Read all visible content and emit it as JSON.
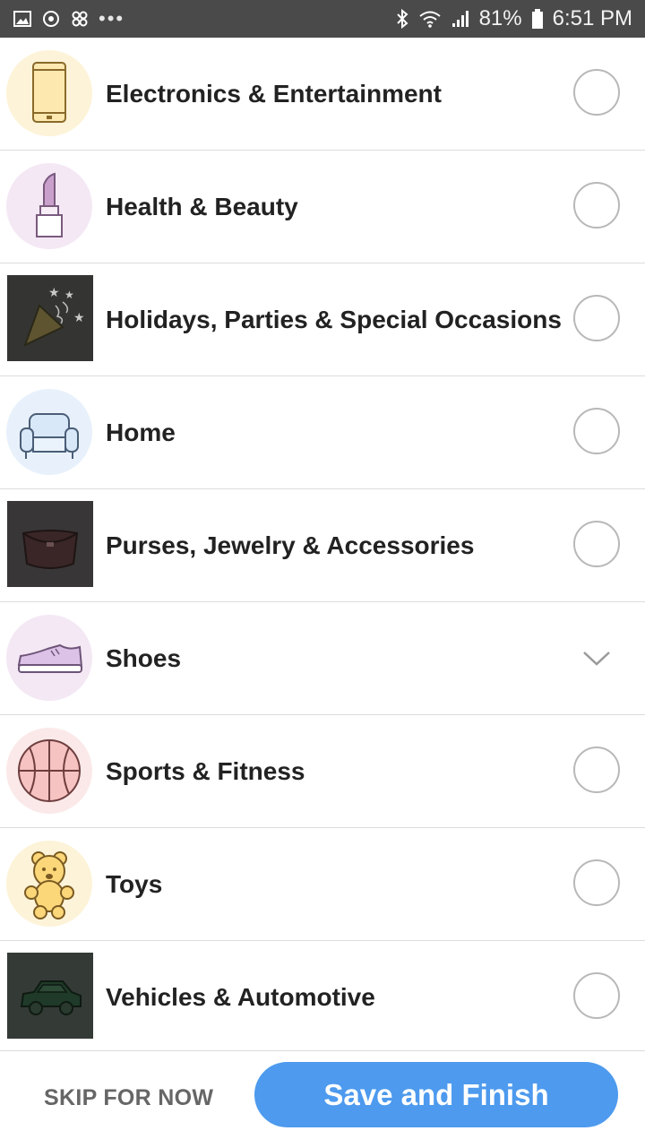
{
  "status_bar": {
    "battery": "81%",
    "time": "6:51 PM",
    "more": "•••",
    "icons": [
      "gallery-icon",
      "sync-icon",
      "pinwheel-icon",
      "bluetooth-icon",
      "wifi-icon",
      "signal-icon",
      "battery-icon"
    ]
  },
  "categories": [
    {
      "label": "Electronics & Entertainment",
      "icon": "smartphone-icon",
      "state": "unselected"
    },
    {
      "label": "Health & Beauty",
      "icon": "lipstick-icon",
      "state": "unselected"
    },
    {
      "label": "Holidays, Parties & Special Occasions",
      "icon": "party-popper-icon",
      "state": "unselected"
    },
    {
      "label": "Home",
      "icon": "armchair-icon",
      "state": "unselected"
    },
    {
      "label": "Purses, Jewelry & Accessories",
      "icon": "purse-icon",
      "state": "unselected"
    },
    {
      "label": "Shoes",
      "icon": "sneaker-icon",
      "state": "selected"
    },
    {
      "label": "Sports & Fitness",
      "icon": "basketball-icon",
      "state": "unselected"
    },
    {
      "label": "Toys",
      "icon": "teddy-bear-icon",
      "state": "unselected"
    },
    {
      "label": "Vehicles & Automotive",
      "icon": "car-icon",
      "state": "unselected"
    }
  ],
  "footer": {
    "skip_label": "SKIP FOR NOW",
    "save_label": "Save and Finish"
  },
  "colors": {
    "status_bar": "#4a4a4a",
    "primary_button": "#4d9aee",
    "divider": "#dcdcdc"
  }
}
